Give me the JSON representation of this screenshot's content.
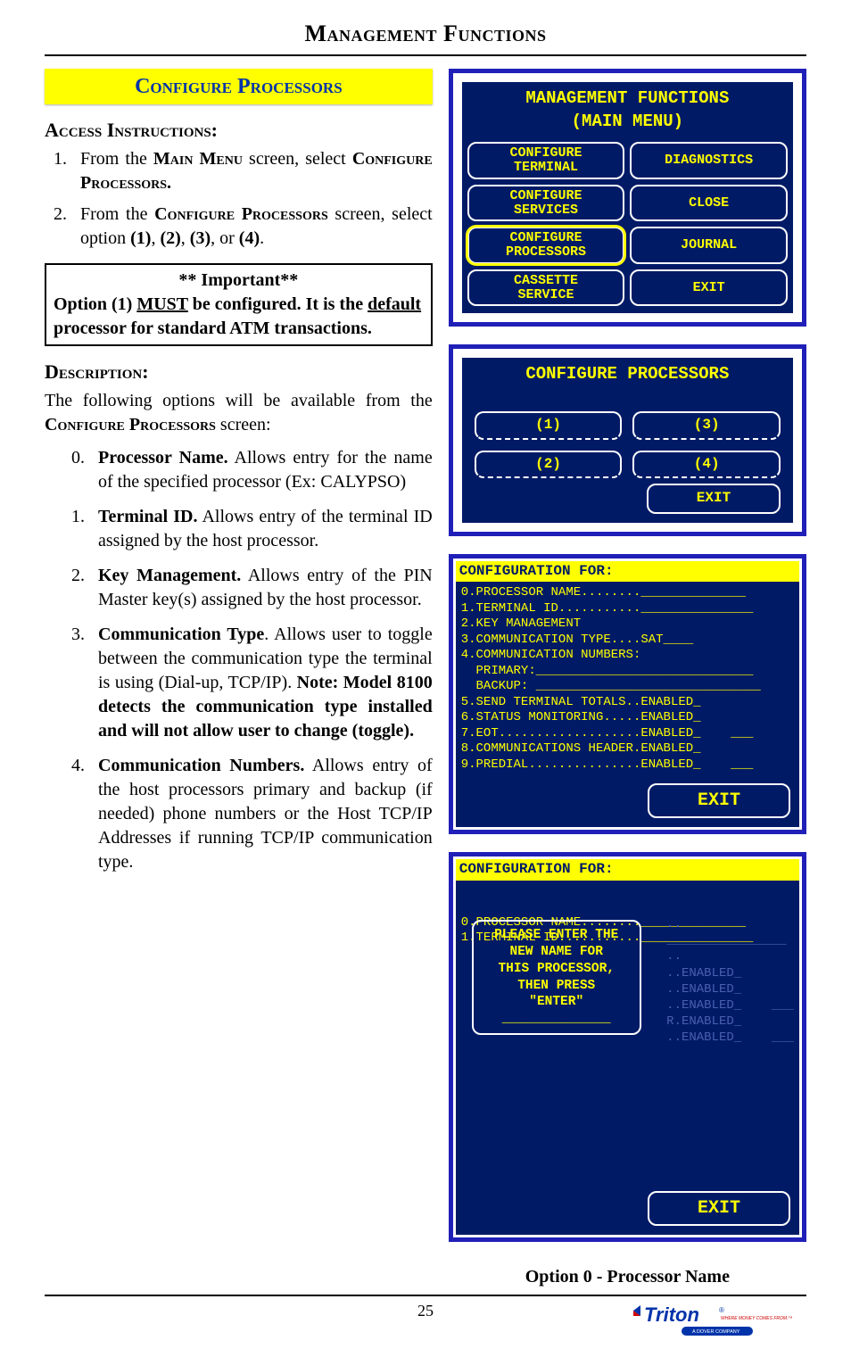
{
  "page_title": "Management Functions",
  "section_title": "Configure Processors",
  "access_hd": "Access Instructions:",
  "access": [
    {
      "pre": "From the ",
      "sc1": "Main Menu",
      "mid": " screen, select ",
      "sc2": "Configure Processors."
    },
    {
      "pre": "From the ",
      "sc1": "Configure Processors",
      "mid": " screen, select option ",
      "b": "(1)",
      "mid2": ", ",
      "b2": "(2)",
      "mid3": ", ",
      "b3": "(3)",
      "mid4": ", or ",
      "b4": "(4)",
      "end": "."
    }
  ],
  "important_title": "** Important**",
  "important_body": "Option (1) MUST be configured. It is the default processor for standard ATM transactions.",
  "desc_hd": "Description:",
  "desc_intro_pre": "The following options will be available from the ",
  "desc_intro_sc": "Configure Processors",
  "desc_intro_post": " screen:",
  "items": [
    {
      "t": "Processor Name.",
      "d": " Allows entry for the name of the specified processor (Ex: CALYPSO)"
    },
    {
      "t": "Terminal ID.",
      "d": "  Allows entry of the terminal ID assigned by the host processor."
    },
    {
      "t": "Key Management.",
      "d": "  Allows entry  of the PIN Master key(s) assigned by the host processor."
    },
    {
      "t": "Communication Type",
      "d": ". Allows user to toggle between the communication type the terminal is using (Dial-up, TCP/IP). Note: Model 8100 detects the communication type installed and will not allow user to change (toggle)."
    },
    {
      "t": "Communication Numbers.",
      "d": " Allows entry of the host processors primary and backup (if needed) phone numbers or the Host TCP/IP Addresses if running TCP/IP communication type."
    }
  ],
  "atm_main": {
    "title": "MANAGEMENT FUNCTIONS\n(MAIN MENU)",
    "buttons": [
      [
        "CONFIGURE\nTERMINAL",
        "DIAGNOSTICS"
      ],
      [
        "CONFIGURE\nSERVICES",
        "CLOSE"
      ],
      [
        "CONFIGURE\nPROCESSORS",
        "JOURNAL"
      ],
      [
        "CASSETTE\nSERVICE",
        "EXIT"
      ]
    ]
  },
  "atm_cp": {
    "title": "CONFIGURE PROCESSORS",
    "nums": [
      [
        "(1)",
        "(3)"
      ],
      [
        "(2)",
        "(4)"
      ]
    ],
    "exit": "EXIT"
  },
  "cfg1": {
    "label": "CONFIGURATION FOR:",
    "body": "0.PROCESSOR NAME........______________\n1.TERMINAL ID..........._______________\n2.KEY MANAGEMENT\n3.COMMUNICATION TYPE....SAT____\n4.COMMUNICATION NUMBERS:\n  PRIMARY:_____________________________\n  BACKUP: ______________________________\n5.SEND TERMINAL TOTALS..ENABLED_\n6.STATUS MONITORING.....ENABLED_\n7.EOT...................ENABLED_    ___\n8.COMMUNICATIONS HEADER.ENABLED_\n9.PREDIAL...............ENABLED_    ___",
    "exit": "EXIT"
  },
  "cfg2": {
    "label": "CONFIGURATION FOR:",
    "body_top": "0.PROCESSOR NAME........______________\n1.TERMINAL ID..........._______________",
    "body_bg": "2                     ..\n3\n  PLEASE ENTER THE    ________________\n4  NEW NAME FOR       ..\n5 THIS PROCESSOR,     ..ENABLED_\n6   THEN PRESS        ..ENABLED_\n7    \"ENTER\"          ..ENABLED_    ___\n8                     R.ENABLED_\n9 ______________      ..ENABLED_    ___",
    "dialog": "PLEASE ENTER THE\nNEW NAME FOR\nTHIS PROCESSOR,\nTHEN PRESS\n\"ENTER\"\n______________",
    "exit": "EXIT"
  },
  "caption": "Option 0 - Processor Name",
  "page_num": "25",
  "logo_name": "Triton",
  "logo_tag": "WHERE MONEY COMES FROM.™",
  "logo_sub": "A DOVER COMPANY"
}
